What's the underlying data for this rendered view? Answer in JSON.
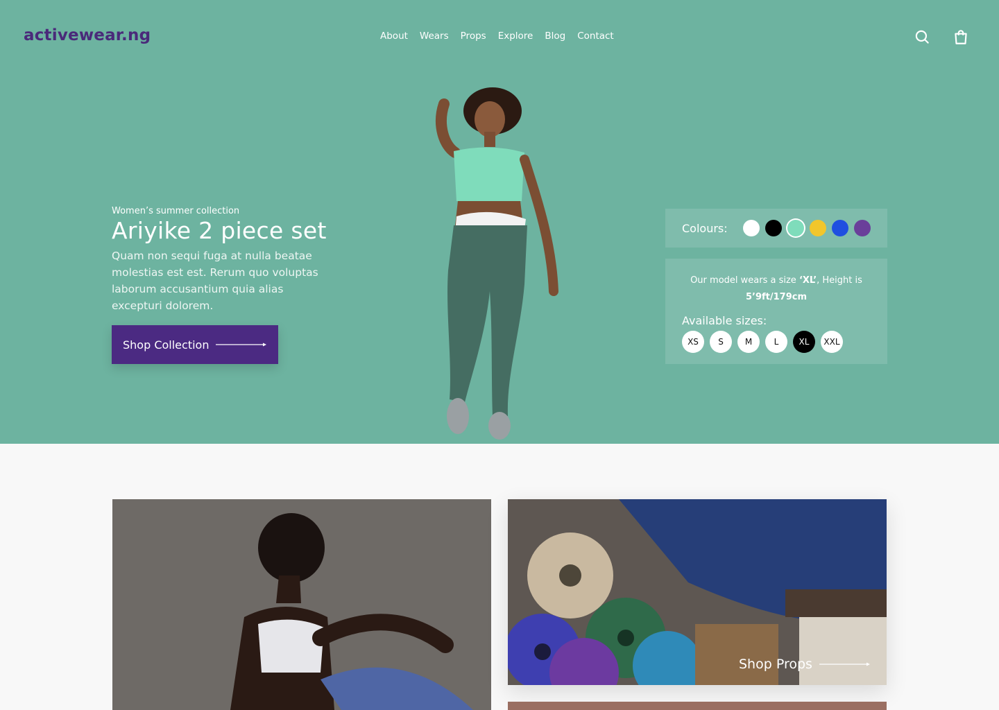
{
  "brand": {
    "logo": "activewear.ng"
  },
  "nav": {
    "items": [
      "About",
      "Wears",
      "Props",
      "Explore",
      "Blog",
      "Contact"
    ]
  },
  "header_icons": [
    "search-icon",
    "shopping-bag-icon"
  ],
  "hero": {
    "eyebrow": "Women’s summer collection",
    "title": "Ariyike 2 piece set",
    "description": "Quam non sequi fuga at nulla beatae molestias est est. Rerum quo voluptas laborum accusantium quia alias excepturi dolorem.",
    "cta_label": "Shop Collection",
    "colours_label": "Colours:",
    "colours": [
      "#ffffff",
      "#000000",
      "#7fdcbb",
      "#f2c62b",
      "#1f4fe0",
      "#6a3f9a"
    ],
    "model_note_prefix": "Our model wears a size ",
    "model_note_size": "‘XL’",
    "model_note_mid": ", Height is",
    "model_note_height": "5’9ft/179cm",
    "sizes_label": "Available sizes:",
    "sizes": [
      "XS",
      "S",
      "M",
      "L",
      "XL",
      "XXL"
    ],
    "selected_size": "XL"
  },
  "categories": {
    "props_label": "Shop Props"
  },
  "colors": {
    "hero_bg": "#6db3a0",
    "brand_purple": "#4b2a82"
  }
}
